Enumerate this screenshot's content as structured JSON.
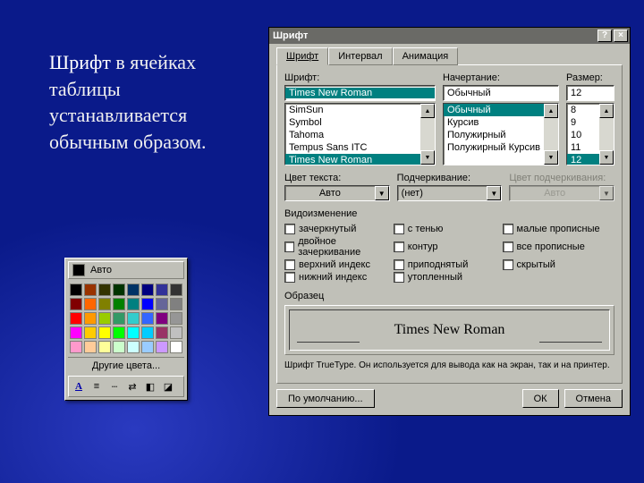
{
  "slide": {
    "lead": "Шрифт",
    "rest": " в ячейках таблицы устанавливается обычным образом."
  },
  "dialog": {
    "title": "Шрифт",
    "help": "?",
    "close": "×",
    "tabs": {
      "font": "Шрифт",
      "spacing": "Интервал",
      "anim": "Анимация"
    },
    "font": {
      "label": "Шрифт:",
      "value": "Times New Roman",
      "list": [
        "SimSun",
        "Symbol",
        "Tahoma",
        "Tempus Sans ITC",
        "Times New Roman"
      ]
    },
    "style": {
      "label": "Начертание:",
      "value": "Обычный",
      "list": [
        "Обычный",
        "Курсив",
        "Полужирный",
        "Полужирный Курсив"
      ]
    },
    "size": {
      "label": "Размер:",
      "value": "12",
      "list": [
        "8",
        "9",
        "10",
        "11",
        "12"
      ]
    },
    "color": {
      "label": "Цвет текста:",
      "value": "Авто"
    },
    "underline": {
      "label": "Подчеркивание:",
      "value": "(нет)"
    },
    "ulcolor": {
      "label": "Цвет подчеркивания:",
      "value": "Авто"
    },
    "effects": {
      "title": "Видоизменение",
      "items": [
        "зачеркнутый",
        "двойное зачеркивание",
        "верхний индекс",
        "нижний индекс",
        "с тенью",
        "контур",
        "приподнятый",
        "утопленный",
        "малые прописные",
        "все прописные",
        "скрытый"
      ]
    },
    "sample": {
      "title": "Образец",
      "text": "Times New Roman"
    },
    "note": "Шрифт TrueType. Он используется для вывода как на экран, так и на принтер.",
    "buttons": {
      "default": "По умолчанию...",
      "ok": "ОК",
      "cancel": "Отмена"
    }
  },
  "palette": {
    "auto": "Авто",
    "more": "Другие цвета...",
    "colors": [
      "#000000",
      "#993300",
      "#333300",
      "#003300",
      "#003366",
      "#000080",
      "#333399",
      "#333333",
      "#800000",
      "#ff6600",
      "#808000",
      "#008000",
      "#008080",
      "#0000ff",
      "#666699",
      "#808080",
      "#ff0000",
      "#ff9900",
      "#99cc00",
      "#339966",
      "#33cccc",
      "#3366ff",
      "#800080",
      "#969696",
      "#ff00ff",
      "#ffcc00",
      "#ffff00",
      "#00ff00",
      "#00ffff",
      "#00ccff",
      "#993366",
      "#c0c0c0",
      "#ff99cc",
      "#ffcc99",
      "#ffff99",
      "#ccffcc",
      "#ccffff",
      "#99ccff",
      "#cc99ff",
      "#ffffff"
    ],
    "tool_a": "A"
  }
}
